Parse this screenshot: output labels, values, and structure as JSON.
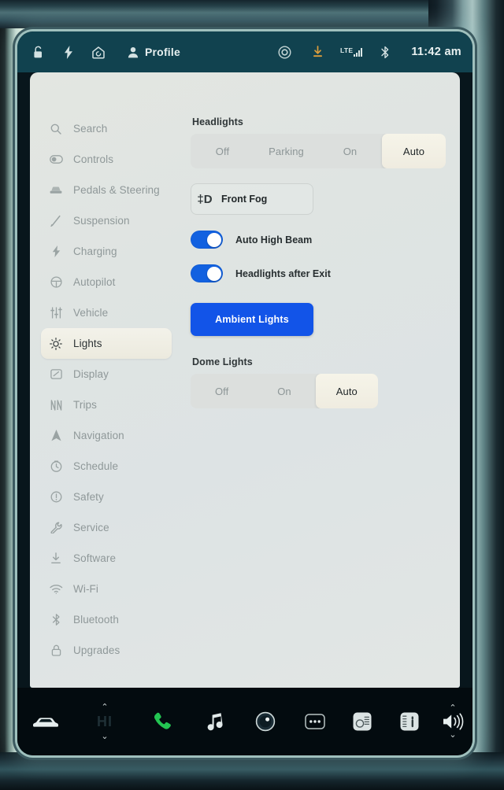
{
  "statusbar": {
    "icons": [
      "unlock-icon",
      "charge-bolt-icon",
      "home-icon"
    ],
    "profile_label": "Profile",
    "right_icons": [
      "sentry-circle-icon",
      "download-icon"
    ],
    "network_label": "LTE",
    "signal_bars": 4,
    "bluetooth_icon": "bluetooth-icon",
    "clock": "11:42 am"
  },
  "sidebar": {
    "items": [
      {
        "label": "Search",
        "icon": "search-icon",
        "selected": false
      },
      {
        "label": "Controls",
        "icon": "controls-icon",
        "selected": false
      },
      {
        "label": "Pedals & Steering",
        "icon": "car-seat-icon",
        "selected": false
      },
      {
        "label": "Suspension",
        "icon": "suspension-icon",
        "selected": false
      },
      {
        "label": "Charging",
        "icon": "bolt-icon",
        "selected": false
      },
      {
        "label": "Autopilot",
        "icon": "steering-wheel-icon",
        "selected": false
      },
      {
        "label": "Vehicle",
        "icon": "sliders-icon",
        "selected": false
      },
      {
        "label": "Lights",
        "icon": "lightbulb-icon",
        "selected": true
      },
      {
        "label": "Display",
        "icon": "display-icon",
        "selected": false
      },
      {
        "label": "Trips",
        "icon": "trips-icon",
        "selected": false
      },
      {
        "label": "Navigation",
        "icon": "navigation-arrow-icon",
        "selected": false
      },
      {
        "label": "Schedule",
        "icon": "clock-icon",
        "selected": false
      },
      {
        "label": "Safety",
        "icon": "alert-circle-icon",
        "selected": false
      },
      {
        "label": "Service",
        "icon": "wrench-icon",
        "selected": false
      },
      {
        "label": "Software",
        "icon": "download-icon",
        "selected": false
      },
      {
        "label": "Wi-Fi",
        "icon": "wifi-icon",
        "selected": false
      },
      {
        "label": "Bluetooth",
        "icon": "bluetooth-icon",
        "selected": false
      },
      {
        "label": "Upgrades",
        "icon": "lock-icon",
        "selected": false
      }
    ]
  },
  "content": {
    "headlights": {
      "title": "Headlights",
      "options": [
        "Off",
        "Parking",
        "On",
        "Auto"
      ],
      "selected": "Auto"
    },
    "front_fog": {
      "label": "Front Fog",
      "icon_text": "‡D",
      "icon": "fog-lamp-icon",
      "active": false
    },
    "toggles": [
      {
        "label": "Auto High Beam",
        "on": true
      },
      {
        "label": "Headlights after Exit",
        "on": true
      }
    ],
    "ambient_lights": {
      "label": "Ambient Lights",
      "color": "#1254e8"
    },
    "dome_lights": {
      "title": "Dome Lights",
      "options": [
        "Off",
        "On",
        "Auto"
      ],
      "selected": "Auto"
    }
  },
  "dock": {
    "car_icon": "car-icon",
    "climate_left": {
      "value": "HI",
      "up": "⌃",
      "down": "⌄"
    },
    "phone_icon": "phone-icon",
    "phone_color": "#23c552",
    "music_icon": "music-note-icon",
    "camera_icon": "dashcam-icon",
    "more_icon": "more-dots-icon",
    "seat_left_icon": "seat-heater-left-icon",
    "seat_right_icon": "seat-heater-right-icon",
    "volume": {
      "icon": "volume-icon",
      "up": "⌃",
      "down": "⌄"
    }
  }
}
